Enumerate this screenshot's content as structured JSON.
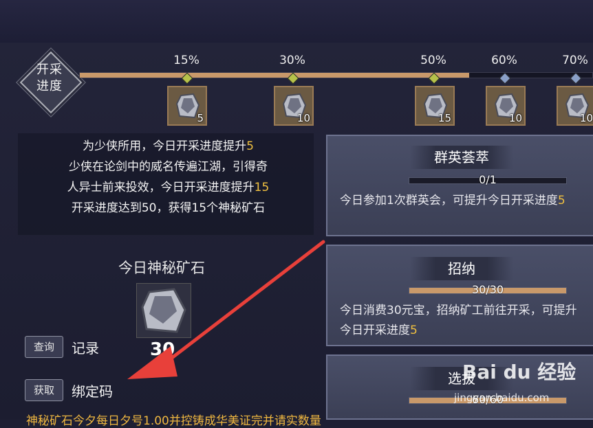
{
  "progress": {
    "label_line1": "开采",
    "label_line2": "进度",
    "fill_fraction": 0.76,
    "milestones": [
      {
        "pct": "15%",
        "count": "5"
      },
      {
        "pct": "30%",
        "count": "10"
      },
      {
        "pct": "50%",
        "count": "15"
      },
      {
        "pct": "60%",
        "count": "10"
      },
      {
        "pct": "70%",
        "count": "10"
      }
    ]
  },
  "info": {
    "line1_a": "为少侠所用，今日开采进度提升",
    "line1_b": "5",
    "line2": "少侠在论剑中的威名传遍江湖，引得奇",
    "line3_a": "人异士前来投效，今日开采进度提升",
    "line3_b": "15",
    "line4": "开采进度达到50，获得15个神秘矿石"
  },
  "today": {
    "title": "今日神秘矿石",
    "count": "30"
  },
  "buttons": {
    "query_tag": "查询",
    "query_text": "记录",
    "get_tag": "获取",
    "get_text": "绑定码"
  },
  "cards": [
    {
      "title": "群英荟萃",
      "progress": "0/1",
      "fill": 0,
      "desc_a": "今日参加1次群英会，可提升今日开采进度",
      "desc_b": "5"
    },
    {
      "title": "招纳",
      "progress": "30/30",
      "fill": 1,
      "desc_a": "今日消费30元宝，招纳矿工前往开采，可提升今日开采进度",
      "desc_b": "5"
    },
    {
      "title": "选拔",
      "progress": "60/60",
      "fill": 1
    }
  ],
  "bottom": {
    "text": "神秘矿石今夕每日夕号1.00并控铸成华美证完并请实数量"
  },
  "watermark": {
    "brand": "Bai du 经验",
    "url": "jingyan.baidu.com"
  },
  "colors": {
    "accent": "#c9996a",
    "highlight": "#f0c040",
    "arrow": "#e8403a"
  }
}
